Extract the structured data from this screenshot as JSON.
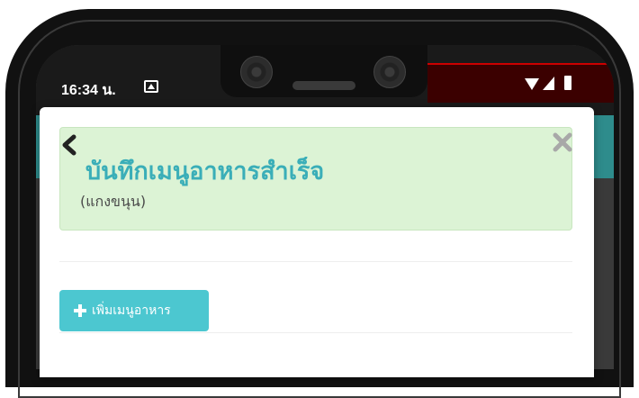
{
  "status_bar": {
    "time": "16:34 น.",
    "icons": [
      "gallery-icon",
      "wifi-icon",
      "signal-icon",
      "battery-icon"
    ]
  },
  "dialog": {
    "title": "บันทึกเมนูอาหารสำเร็จ",
    "subtitle": "(แกงขนุน)",
    "back_icon": "chevron-left-icon",
    "close_icon": "close-icon",
    "add_button_label": "เพิ่มเมนูอาหาร",
    "add_button_icon": "plus-icon"
  },
  "colors": {
    "alert_background": "#dcf3d5",
    "title": "#3aaeb8",
    "button": "#4cc7d0",
    "app_bar": "#2e8c8c"
  }
}
